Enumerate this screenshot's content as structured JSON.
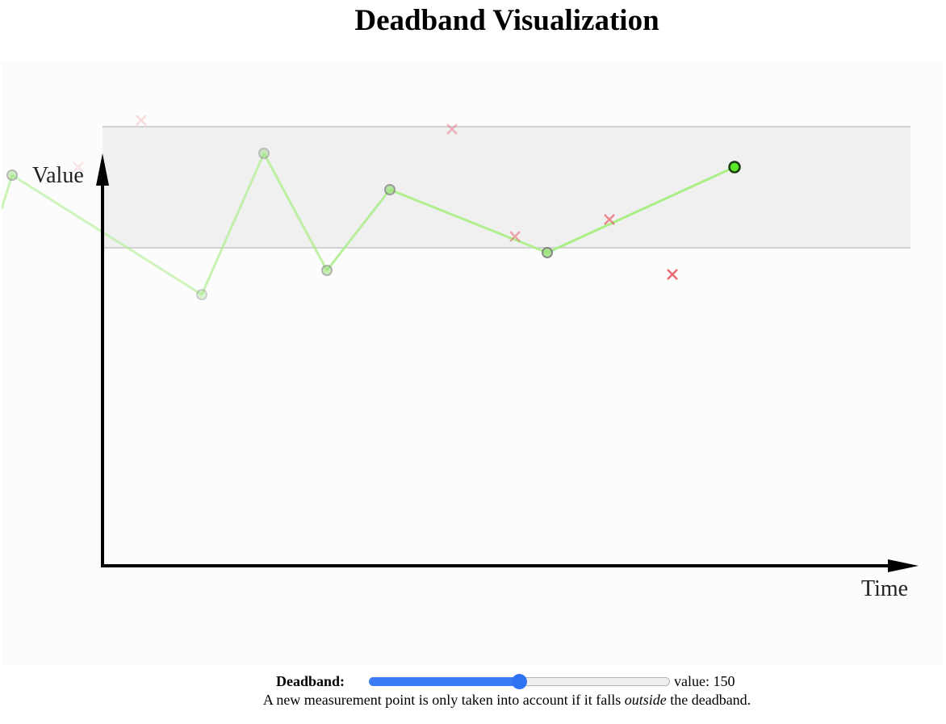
{
  "page": {
    "title": "Deadband Visualization"
  },
  "axes": {
    "y_label": "Value",
    "x_label": "Time"
  },
  "colors": {
    "band_fill": "#f0f0f0",
    "band_edge": "#d2d2d2",
    "accepted_line": "#a9ef86",
    "accepted_point": "#9be17c",
    "current_point": "#5ae62a",
    "rejected": "#e85a64",
    "axis": "#000000",
    "slider_accent": "#2f72f2"
  },
  "controls": {
    "deadband_label": "Deadband:",
    "deadband_value": 150,
    "deadband_min": 0,
    "deadband_max": 300,
    "value_prefix": "value: "
  },
  "hint": {
    "before": "A new measurement point is only taken into account if it falls ",
    "emphasis": "outside",
    "after": " the deadband."
  },
  "chart_data": {
    "type": "scatter",
    "band": {
      "low": 393,
      "high": 543
    },
    "accepted_points": [
      {
        "t": 15,
        "v": 483,
        "opacity": 0.5
      },
      {
        "t": 250,
        "v": 335,
        "opacity": 0.35
      },
      {
        "t": 327,
        "v": 510,
        "opacity": 0.45
      },
      {
        "t": 405,
        "v": 365,
        "opacity": 0.55
      },
      {
        "t": 483,
        "v": 465,
        "opacity": 0.7
      },
      {
        "t": 678,
        "v": 387,
        "opacity": 0.85
      },
      {
        "t": 910,
        "v": 493,
        "opacity": 1.0,
        "current": true
      }
    ],
    "rejected_points": [
      {
        "t": 97,
        "v": 493,
        "opacity": 0.15
      },
      {
        "t": 175,
        "v": 551,
        "opacity": 0.2
      },
      {
        "t": 560,
        "v": 540,
        "opacity": 0.4
      },
      {
        "t": 638,
        "v": 407,
        "opacity": 0.5
      },
      {
        "t": 755,
        "v": 428,
        "opacity": 0.7
      },
      {
        "t": 833,
        "v": 360,
        "opacity": 0.9
      }
    ]
  }
}
